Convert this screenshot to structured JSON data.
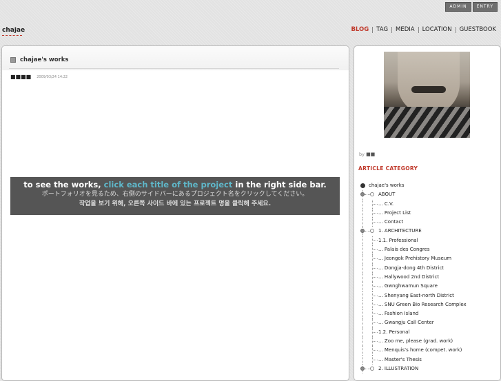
{
  "admin_bar": {
    "admin": "ADMIN",
    "entry": "ENTRY"
  },
  "site": {
    "title": "chajae"
  },
  "nav": {
    "blog": "BLOG",
    "tag": "TAG",
    "media": "MEDIA",
    "location": "LOCATION",
    "guestbook": "GUESTBOOK"
  },
  "post": {
    "title": "chajae's works",
    "author_boxes": "■■■■",
    "date": "2009/03/24 14:22",
    "banner_line1_a": "to see the works,",
    "banner_line1_hl": "click each title of the project",
    "banner_line1_b": "in the right side bar.",
    "banner_line2": "ポートフォリオを見るため、右側のサイドバーにあるプロジェクト名をクリックしてください。",
    "banner_line3": "작업을 보기 위해, 오른쪽 사이드 바에 있는 프로젝트 명을 클릭해 주세요."
  },
  "sidebar": {
    "by_label": "by",
    "by_boxes": "■■",
    "category_heading": "ARTICLE CATEGORY",
    "root": "chajae's works",
    "items": [
      {
        "label": "ABOUT",
        "level": 1,
        "knob": true
      },
      {
        "label": "... C.V.",
        "level": 2
      },
      {
        "label": "... Project List",
        "level": 2
      },
      {
        "label": "... Contact",
        "level": 2
      },
      {
        "label": "1. ARCHITECTURE",
        "level": 1,
        "knob": true
      },
      {
        "label": "1.1. Professional",
        "level": 2
      },
      {
        "label": "... Palais des Congres",
        "level": 2
      },
      {
        "label": "... Jeongok Prehistory Museum",
        "level": 2
      },
      {
        "label": "... Dongja-dong 4th District",
        "level": 2
      },
      {
        "label": "... Hallywood 2nd District",
        "level": 2
      },
      {
        "label": "... Gwnghwamun Square",
        "level": 2
      },
      {
        "label": "... Shenyang East-north District",
        "level": 2
      },
      {
        "label": "... SNU Green Bio Research Complex",
        "level": 2
      },
      {
        "label": "... Fashion Island",
        "level": 2
      },
      {
        "label": "... Gwangju Call Center",
        "level": 2
      },
      {
        "label": "1.2. Personal",
        "level": 2
      },
      {
        "label": "... Zoo me, please (grad. work)",
        "level": 2
      },
      {
        "label": "... Menquis's home (compet. work)",
        "level": 2
      },
      {
        "label": "... Master's Thesis",
        "level": 2
      },
      {
        "label": "2. ILLUSTRATION",
        "level": 1,
        "knob": true
      }
    ]
  },
  "colors": {
    "accent": "#c0392b",
    "highlight": "#5fb7c9",
    "banner_bg": "#555555"
  }
}
